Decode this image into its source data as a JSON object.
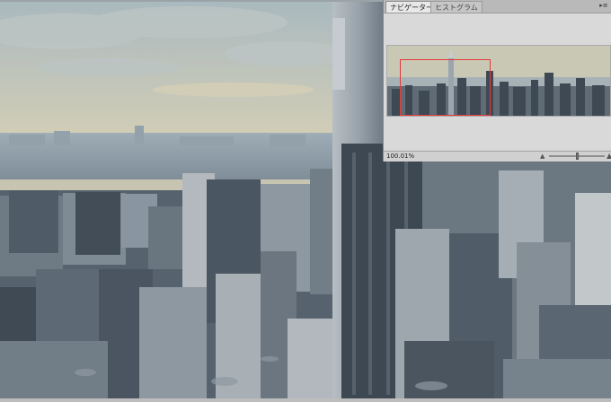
{
  "navigator": {
    "tabs": [
      {
        "label": "ナビゲーター",
        "active": true
      },
      {
        "label": "ヒストグラム",
        "active": false
      }
    ],
    "zoom": "100.01%",
    "menu_icon": "panel-menu-icon",
    "view_rect_color": "#e43a3a"
  },
  "icons": {
    "zoom_out": "small-mountain-icon",
    "zoom_in": "large-mountain-icon"
  },
  "colors": {
    "sky": "#c9c7b4",
    "haze": "#a6b4bd",
    "buildings": "#5d6b76",
    "panel": "#d4d4d4"
  }
}
